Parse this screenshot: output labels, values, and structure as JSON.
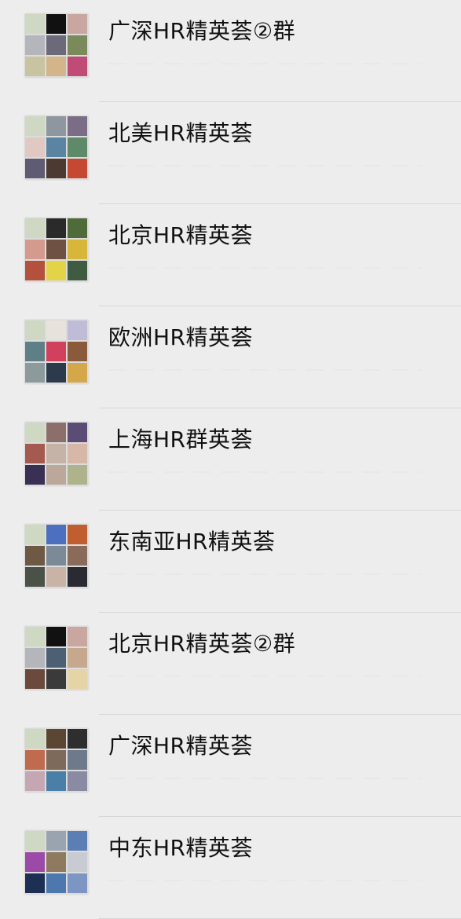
{
  "chats": [
    {
      "name": "广深HR精英荟②群",
      "tiles": [
        "#cfd8c2",
        "#111111",
        "#c9a7a0",
        "#b4b6bc",
        "#6c6a7a",
        "#7a8a5a",
        "#c8c3a0",
        "#d3b48b",
        "#c04b76"
      ]
    },
    {
      "name": "北美HR精英荟",
      "tiles": [
        "#cfd8c2",
        "#8e969f",
        "#7b6d86",
        "#e0c9c2",
        "#5a84a2",
        "#5f8a6a",
        "#5f5b72",
        "#4c3a32",
        "#c44832"
      ]
    },
    {
      "name": "北京HR精英荟",
      "tiles": [
        "#cfd8c2",
        "#2a2a2a",
        "#4f6b39",
        "#d49a8e",
        "#6e5143",
        "#d7b63a",
        "#b3513c",
        "#e3d347",
        "#3f5b42"
      ]
    },
    {
      "name": "欧洲HR精英荟",
      "tiles": [
        "#cfd8c2",
        "#e7e2dc",
        "#c0bbd6",
        "#5e7f86",
        "#d1405c",
        "#8a5b3a",
        "#8c9a9c",
        "#2d3a4c",
        "#d4a84a"
      ]
    },
    {
      "name": "上海HR群英荟",
      "tiles": [
        "#cfd8c2",
        "#8c6f6a",
        "#5a4c74",
        "#a45a4e",
        "#c4b3a6",
        "#d6b7a8",
        "#3a3054",
        "#bca89a",
        "#aeb38c"
      ]
    },
    {
      "name": "东南亚HR精英荟",
      "tiles": [
        "#cfd8c2",
        "#4c6fbf",
        "#c05e2f",
        "#6e5a44",
        "#7c8a98",
        "#8a6a58",
        "#4a5248",
        "#c9b2a6",
        "#2a2a33"
      ]
    },
    {
      "name": "北京HR精英荟②群",
      "tiles": [
        "#cfd8c2",
        "#111111",
        "#c9a7a0",
        "#b4b6bc",
        "#4d5f73",
        "#c5a88e",
        "#6b4a3d",
        "#3a3a3a",
        "#e5d4a6"
      ]
    },
    {
      "name": "广深HR精英荟",
      "tiles": [
        "#cfd8c2",
        "#5a4632",
        "#2e2e2e",
        "#c06a4e",
        "#7d6a5a",
        "#6e7a8c",
        "#c5a7b4",
        "#4a7fa8",
        "#8a8aa3"
      ]
    },
    {
      "name": "中东HR精英荟",
      "tiles": [
        "#cfd8c2",
        "#9aa4b0",
        "#5b7fb5",
        "#9c4aa8",
        "#8e7a5e",
        "#c9cbd2",
        "#1e2f54",
        "#4d78ad",
        "#7d95c2"
      ]
    }
  ]
}
